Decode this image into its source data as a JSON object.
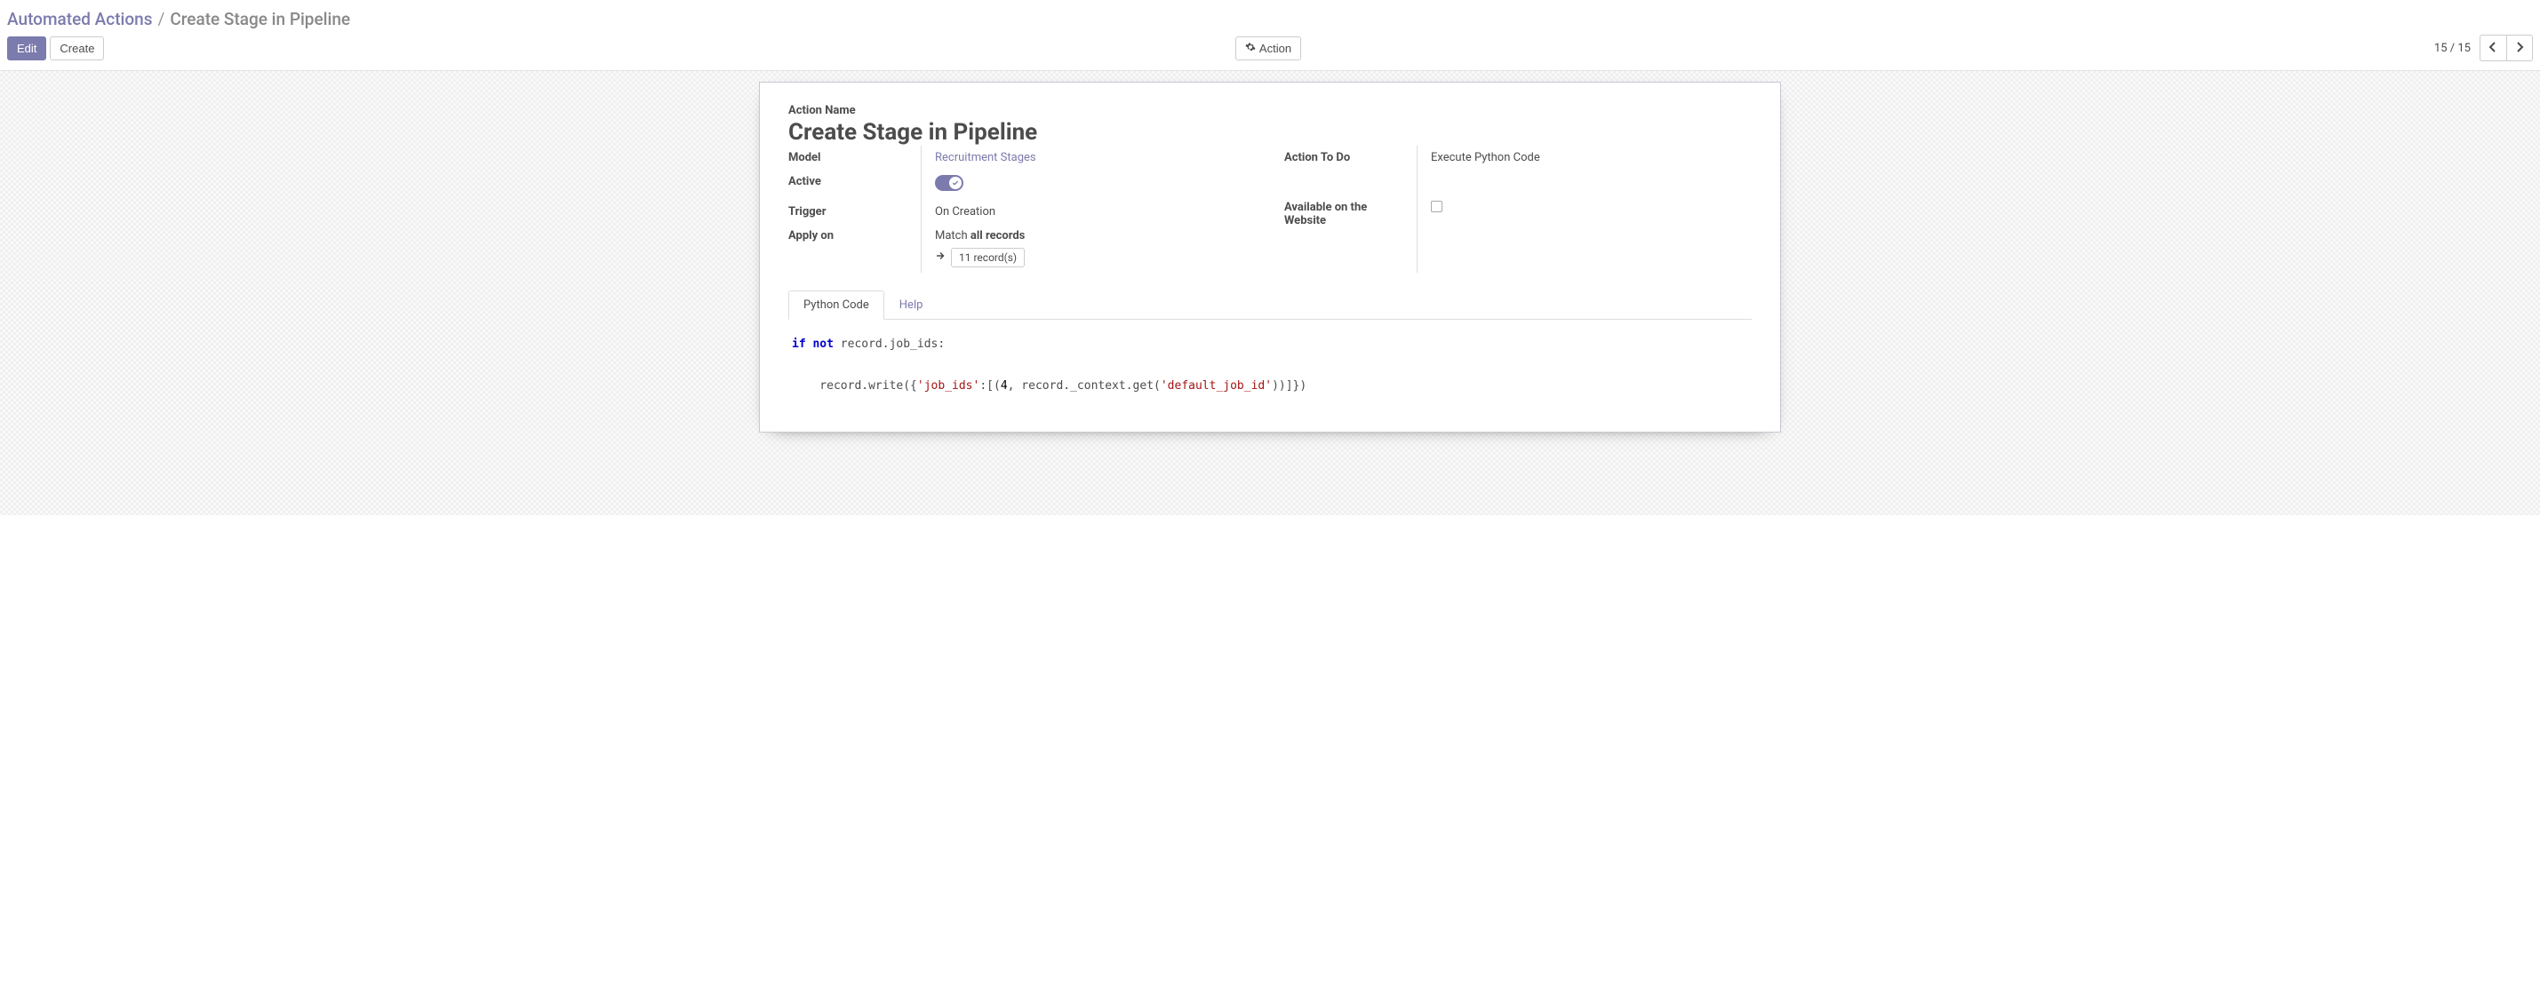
{
  "breadcrumb": {
    "parent": "Automated Actions",
    "sep": "/",
    "current": "Create Stage in Pipeline"
  },
  "toolbar": {
    "edit_label": "Edit",
    "create_label": "Create",
    "action_label": "Action"
  },
  "pager": {
    "current": "15",
    "sep": "/",
    "total": "15"
  },
  "form": {
    "action_name_label": "Action Name",
    "title": "Create Stage in Pipeline",
    "left": {
      "model_label": "Model",
      "model_value": "Recruitment Stages",
      "active_label": "Active",
      "active_on": true,
      "trigger_label": "Trigger",
      "trigger_value": "On Creation",
      "apply_on_label": "Apply on",
      "match_prefix": "Match ",
      "match_bold": "all records",
      "records_count": "11 record(s)"
    },
    "right": {
      "action_to_do_label": "Action To Do",
      "action_to_do_value": "Execute Python Code",
      "available_website_label": "Available on the Website",
      "available_website_checked": false
    }
  },
  "tabs": {
    "python_code": "Python Code",
    "help": "Help"
  },
  "code": {
    "line1_kw1": "if",
    "line1_kw2": "not",
    "line1_rest": " record.job_ids:",
    "line2_a": "    record.write({",
    "line2_str1": "'job_ids'",
    "line2_b": ":[(",
    "line2_num": "4",
    "line2_c": ", record._context.get(",
    "line2_str2": "'default_job_id'",
    "line2_d": "))]})"
  }
}
